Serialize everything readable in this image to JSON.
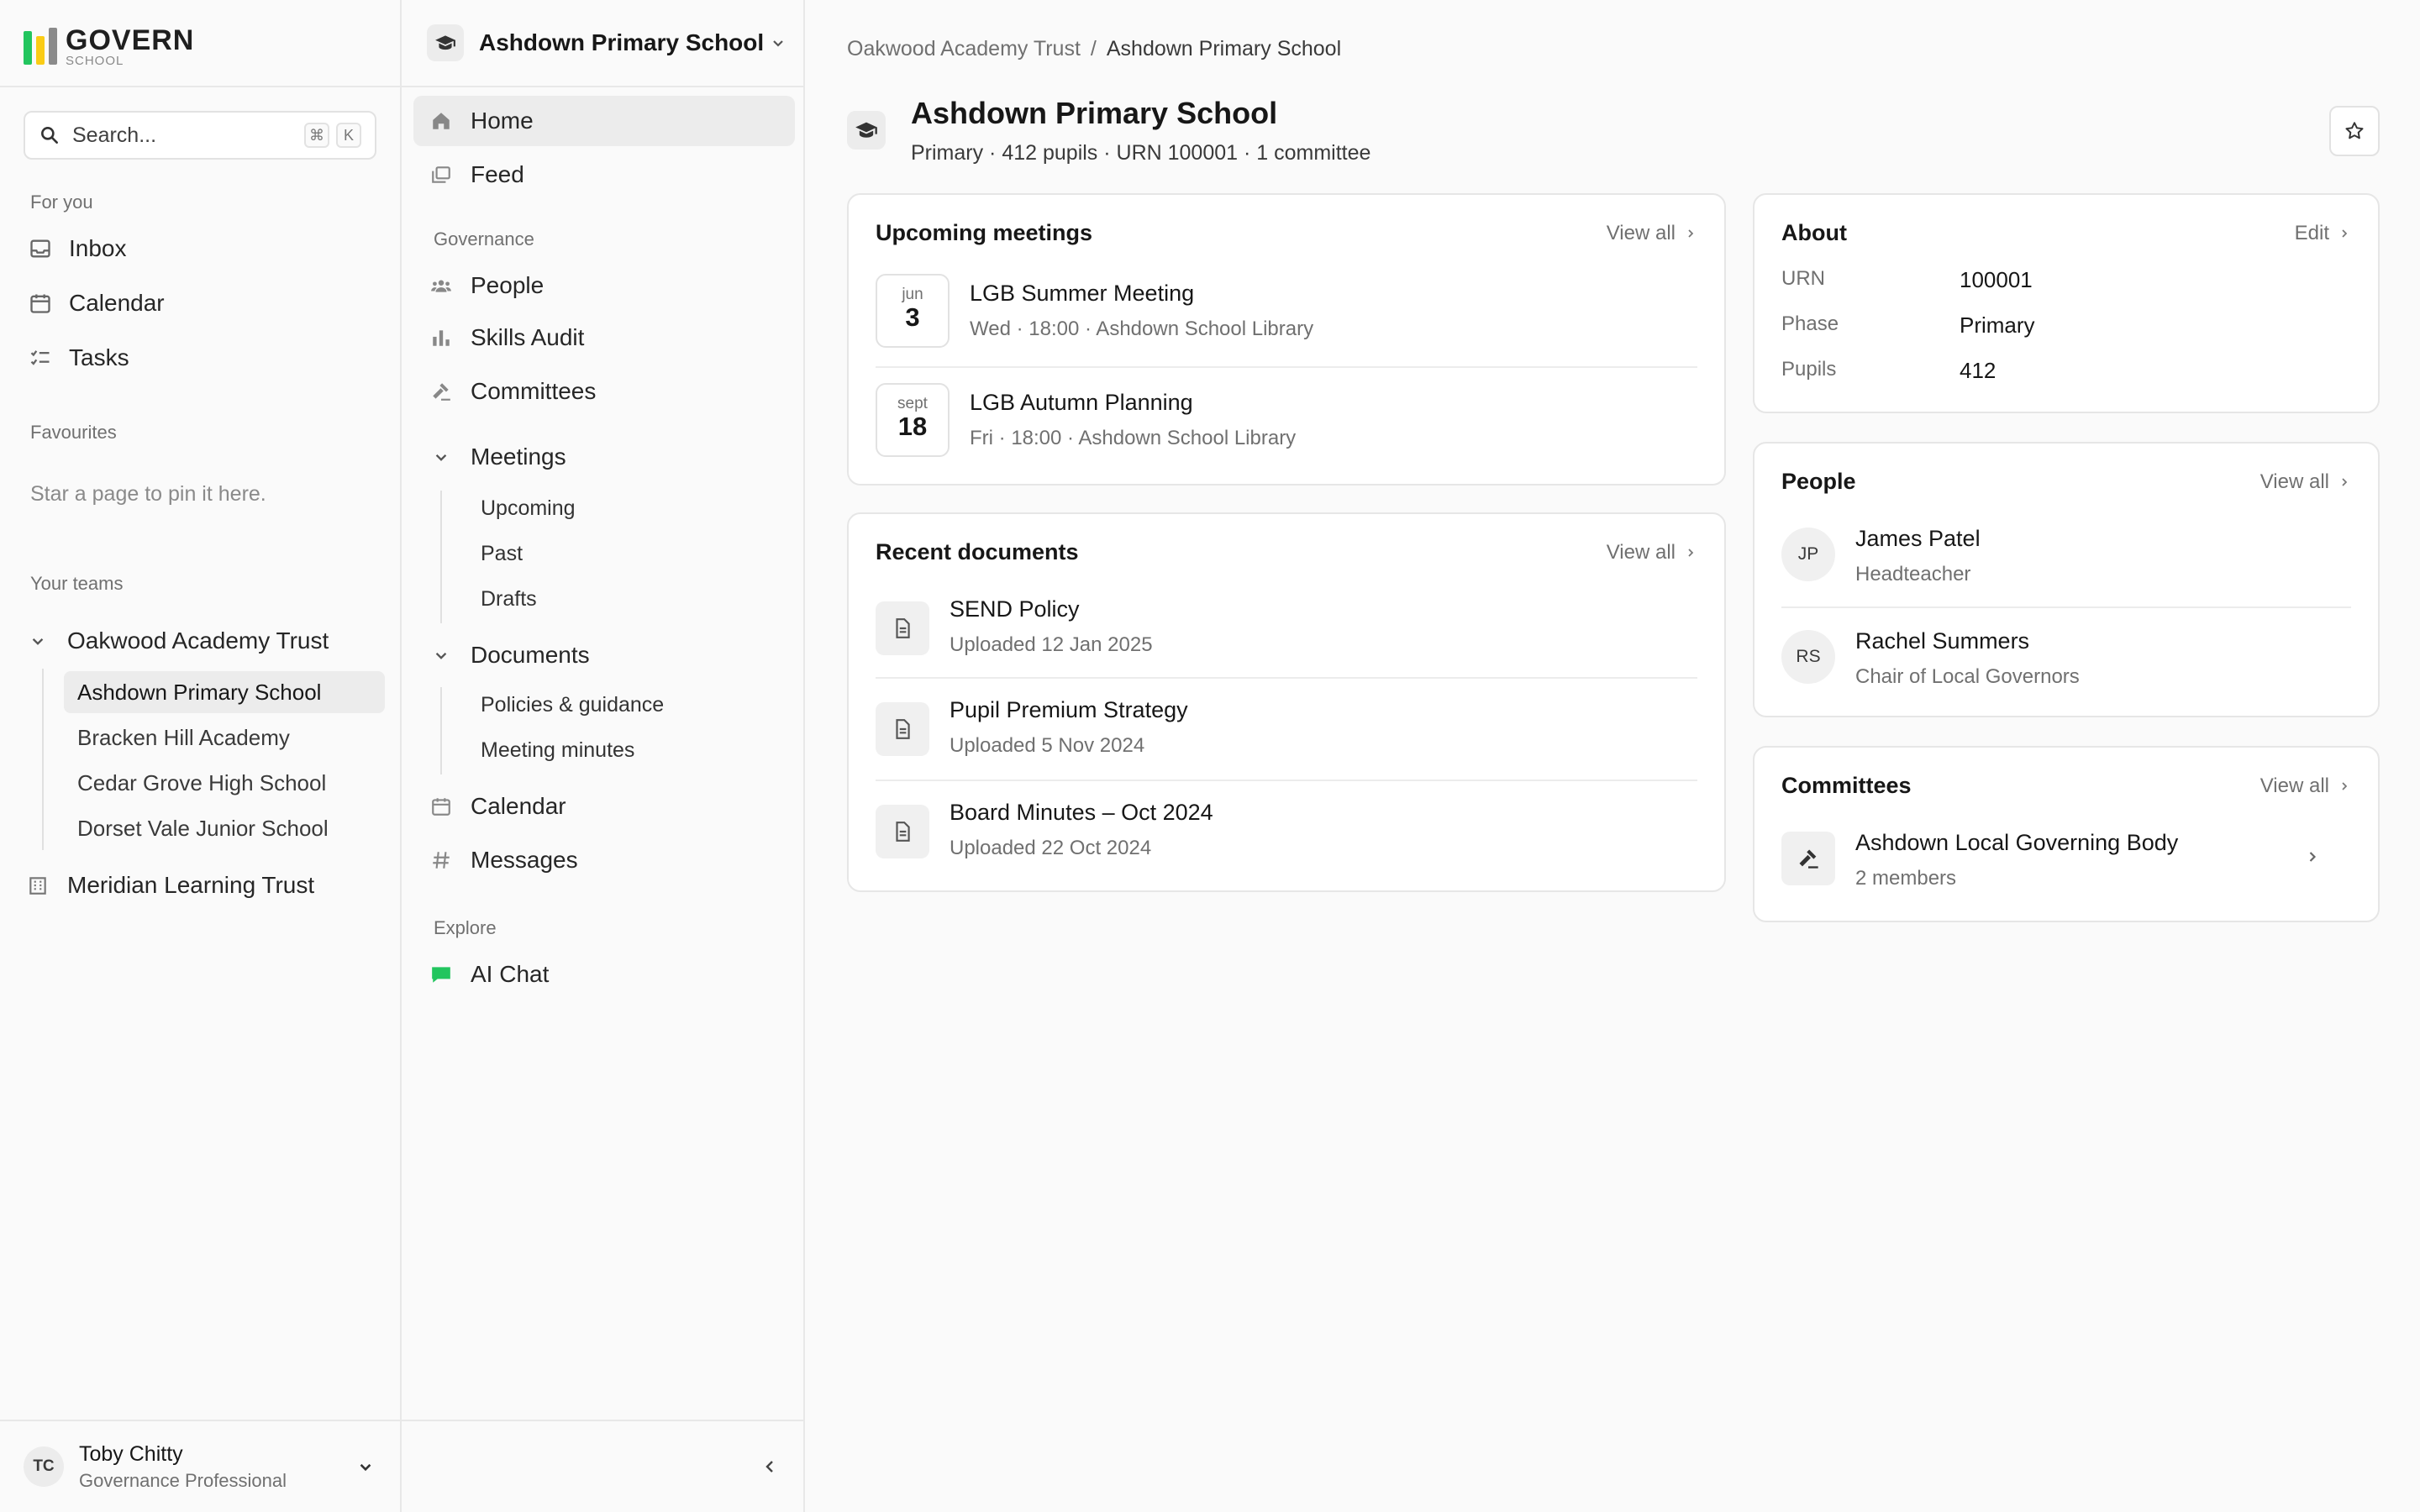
{
  "brand": {
    "name": "GOVERN",
    "sub": "SCHOOL",
    "colors": [
      "#22c55e",
      "#facc15",
      "#8b8b8b"
    ]
  },
  "search": {
    "placeholder": "Search...",
    "shortcut": [
      "⌘",
      "K"
    ]
  },
  "sidebar": {
    "for_you_label": "For you",
    "for_you": [
      {
        "label": "Inbox",
        "icon": "inbox-icon"
      },
      {
        "label": "Calendar",
        "icon": "calendar-icon"
      },
      {
        "label": "Tasks",
        "icon": "tasks-icon"
      }
    ],
    "favourites_label": "Favourites",
    "favourites_hint": "Star a page to pin it here.",
    "teams_label": "Your teams",
    "teams": [
      {
        "name": "Oakwood Academy Trust",
        "expanded": true,
        "schools": [
          "Ashdown Primary School",
          "Bracken Hill Academy",
          "Cedar Grove High School",
          "Dorset Vale Junior School"
        ],
        "active_school": "Ashdown Primary School"
      },
      {
        "name": "Meridian Learning Trust",
        "expanded": false
      }
    ]
  },
  "user": {
    "initials": "TC",
    "name": "Toby Chitty",
    "role": "Governance Professional"
  },
  "school_nav": {
    "school_name": "Ashdown Primary School",
    "home": "Home",
    "feed": "Feed",
    "governance_label": "Governance",
    "governance": [
      "People",
      "Skills Audit",
      "Committees"
    ],
    "meetings": {
      "label": "Meetings",
      "items": [
        "Upcoming",
        "Past",
        "Drafts"
      ]
    },
    "documents": {
      "label": "Documents",
      "items": [
        "Policies & guidance",
        "Meeting minutes"
      ]
    },
    "calendar": "Calendar",
    "messages": "Messages",
    "explore_label": "Explore",
    "ai_chat": "AI Chat",
    "collapse_icon": "chevron-left-icon"
  },
  "main": {
    "breadcrumb": {
      "parent": "Oakwood Academy Trust",
      "separator": "/",
      "current": "Ashdown Primary School"
    },
    "title": "Ashdown Primary School",
    "meta": "Primary · 412 pupils · URN 100001 · 1 committee",
    "meetings": {
      "title": "Upcoming meetings",
      "link": "View all",
      "items": [
        {
          "month": "jun",
          "day": "3",
          "title": "LGB Summer Meeting",
          "sub": "Wed · 18:00 · Ashdown School Library"
        },
        {
          "month": "sept",
          "day": "18",
          "title": "LGB Autumn Planning",
          "sub": "Fri · 18:00 · Ashdown School Library"
        }
      ]
    },
    "documents": {
      "title": "Recent documents",
      "link": "View all",
      "items": [
        {
          "title": "SEND Policy",
          "sub": "Uploaded 12 Jan 2025"
        },
        {
          "title": "Pupil Premium Strategy",
          "sub": "Uploaded 5 Nov 2024"
        },
        {
          "title": "Board Minutes – Oct 2024",
          "sub": "Uploaded 22 Oct 2024"
        }
      ]
    },
    "about": {
      "title": "About",
      "link": "Edit",
      "rows": [
        {
          "k": "URN",
          "v": "100001"
        },
        {
          "k": "Phase",
          "v": "Primary"
        },
        {
          "k": "Pupils",
          "v": "412"
        }
      ]
    },
    "people": {
      "title": "People",
      "link": "View all",
      "items": [
        {
          "initials": "JP",
          "name": "James Patel",
          "role": "Headteacher"
        },
        {
          "initials": "RS",
          "name": "Rachel Summers",
          "role": "Chair of Local Governors"
        }
      ]
    },
    "committees": {
      "title": "Committees",
      "link": "View all",
      "items": [
        {
          "name": "Ashdown Local Governing Body",
          "sub": "2 members"
        }
      ]
    }
  }
}
